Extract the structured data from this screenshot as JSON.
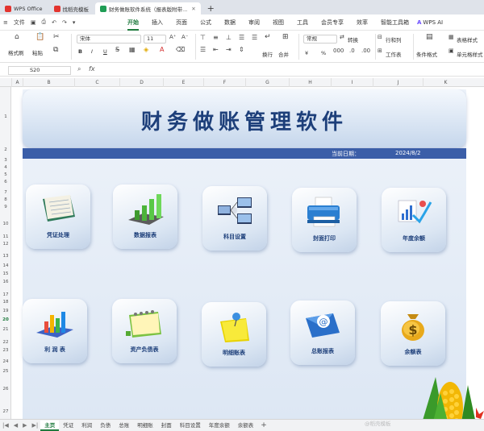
{
  "app_tabs": [
    {
      "label": "WPS Office",
      "color": "#e3342f"
    },
    {
      "label": "找稻壳模板",
      "color": "#e3342f"
    },
    {
      "label": "财务做账软件系统（报表版附带...",
      "color": "#1f9d55"
    }
  ],
  "menu": {
    "file": "文件",
    "tabs": [
      "开始",
      "插入",
      "页面",
      "公式",
      "数据",
      "审阅",
      "视图",
      "工具",
      "会员专享",
      "效率",
      "智能工具箱"
    ],
    "active_tab": "开始",
    "wps_ai": "WPS AI"
  },
  "toolbar": {
    "format_painter": "格式刷",
    "paste": "粘贴",
    "font_name": "宋体",
    "font_size": "11",
    "wrap": "换行",
    "merge": "合并",
    "number_format": "常规",
    "convert": "转换",
    "row_col": "行和列",
    "worksheet": "工作表",
    "cond_format": "条件格式",
    "table_style": "表格样式",
    "cell_style": "单元格样式",
    "bold": "B",
    "italic": "I",
    "underline": "U",
    "currency": "¥",
    "percent": "%"
  },
  "formula_bar": {
    "cell_ref": "S20",
    "fx": "fx"
  },
  "columns": [
    "A",
    "B",
    "C",
    "D",
    "E",
    "F",
    "G",
    "H",
    "I",
    "J",
    "K"
  ],
  "rows": [
    "1",
    "2",
    "3",
    "4",
    "5",
    "6",
    "7",
    "8",
    "9",
    "10",
    "11",
    "12",
    "13",
    "14",
    "15",
    "16",
    "17",
    "18",
    "19",
    "20",
    "21",
    "22",
    "23",
    "24",
    "25",
    "26",
    "27"
  ],
  "selected_row": "20",
  "sheet": {
    "title": "财务做账管理软件",
    "date_label": "当前日期：",
    "date_value": "2024/8/2"
  },
  "tiles_row1": [
    {
      "label": "凭证处理",
      "icon": "ledger-book-icon"
    },
    {
      "label": "数据报表",
      "icon": "bar-chart-3d-icon"
    },
    {
      "label": "科目设置",
      "icon": "computer-network-icon"
    },
    {
      "label": "封面打印",
      "icon": "printer-icon"
    },
    {
      "label": "年度余额",
      "icon": "trend-chart-icon"
    }
  ],
  "tiles_row2": [
    {
      "label": "利 润 表",
      "icon": "colorful-bar-chart-icon"
    },
    {
      "label": "资产负债表",
      "icon": "calendar-notebook-icon"
    },
    {
      "label": "明细账表",
      "icon": "sticky-note-pin-icon"
    },
    {
      "label": "总账报表",
      "icon": "email-at-icon"
    },
    {
      "label": "余额表",
      "icon": "money-bag-icon"
    }
  ],
  "sheet_tabs": [
    "主页",
    "凭证",
    "利润",
    "负债",
    "总账",
    "明细账",
    "封面",
    "科目设置",
    "年度余额",
    "余额表"
  ],
  "active_sheet": "主页",
  "watermark": "@稻壳模板"
}
